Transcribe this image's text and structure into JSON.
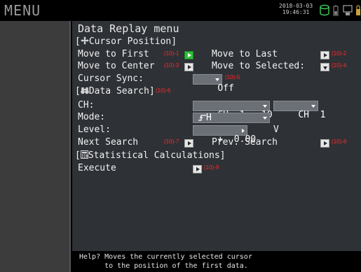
{
  "topbar": {
    "menu_label": "MENU",
    "date": "2018-03-03",
    "time": "19:46:31"
  },
  "panel": {
    "heading": "Data Replay menu",
    "cursor_position": {
      "title": "Cursor Position]",
      "bracket_open": "[",
      "move_first_label": "Move to First",
      "move_first_ann": "(10)-1",
      "move_last_label": "Move to Last",
      "move_last_ann": "(10)-2",
      "move_center_label": "Move to Center",
      "move_center_ann": "(10)-3",
      "move_selected_label": "Move to Selected:",
      "move_selected_ann": "(10)-4",
      "sync_label": "Cursor Sync:",
      "sync_value": "Off",
      "sync_ann": "(10)-5"
    },
    "data_search": {
      "title": "Data Search]",
      "bracket_open": "[",
      "title_ann": "(10)-6",
      "ch_label": "CH:",
      "ch_range_value": "CH  1 - 10",
      "ch_single_value": "CH  1",
      "mode_label": "Mode:",
      "mode_value": "H",
      "level_label": "Level:",
      "level_value": "+  0.00",
      "level_unit": "V",
      "next_label": "Next Search",
      "next_ann": "(10)-7",
      "prev_label": "Prev. Search",
      "prev_ann": "(10)-8"
    },
    "statistical": {
      "title": "Statistical Calculations]",
      "bracket_open": "[",
      "execute_label": "Execute",
      "execute_ann": "(10)-9"
    }
  },
  "help": {
    "line1": "Help? Moves the currently selected cursor",
    "line2": "      to the position of the first data."
  }
}
